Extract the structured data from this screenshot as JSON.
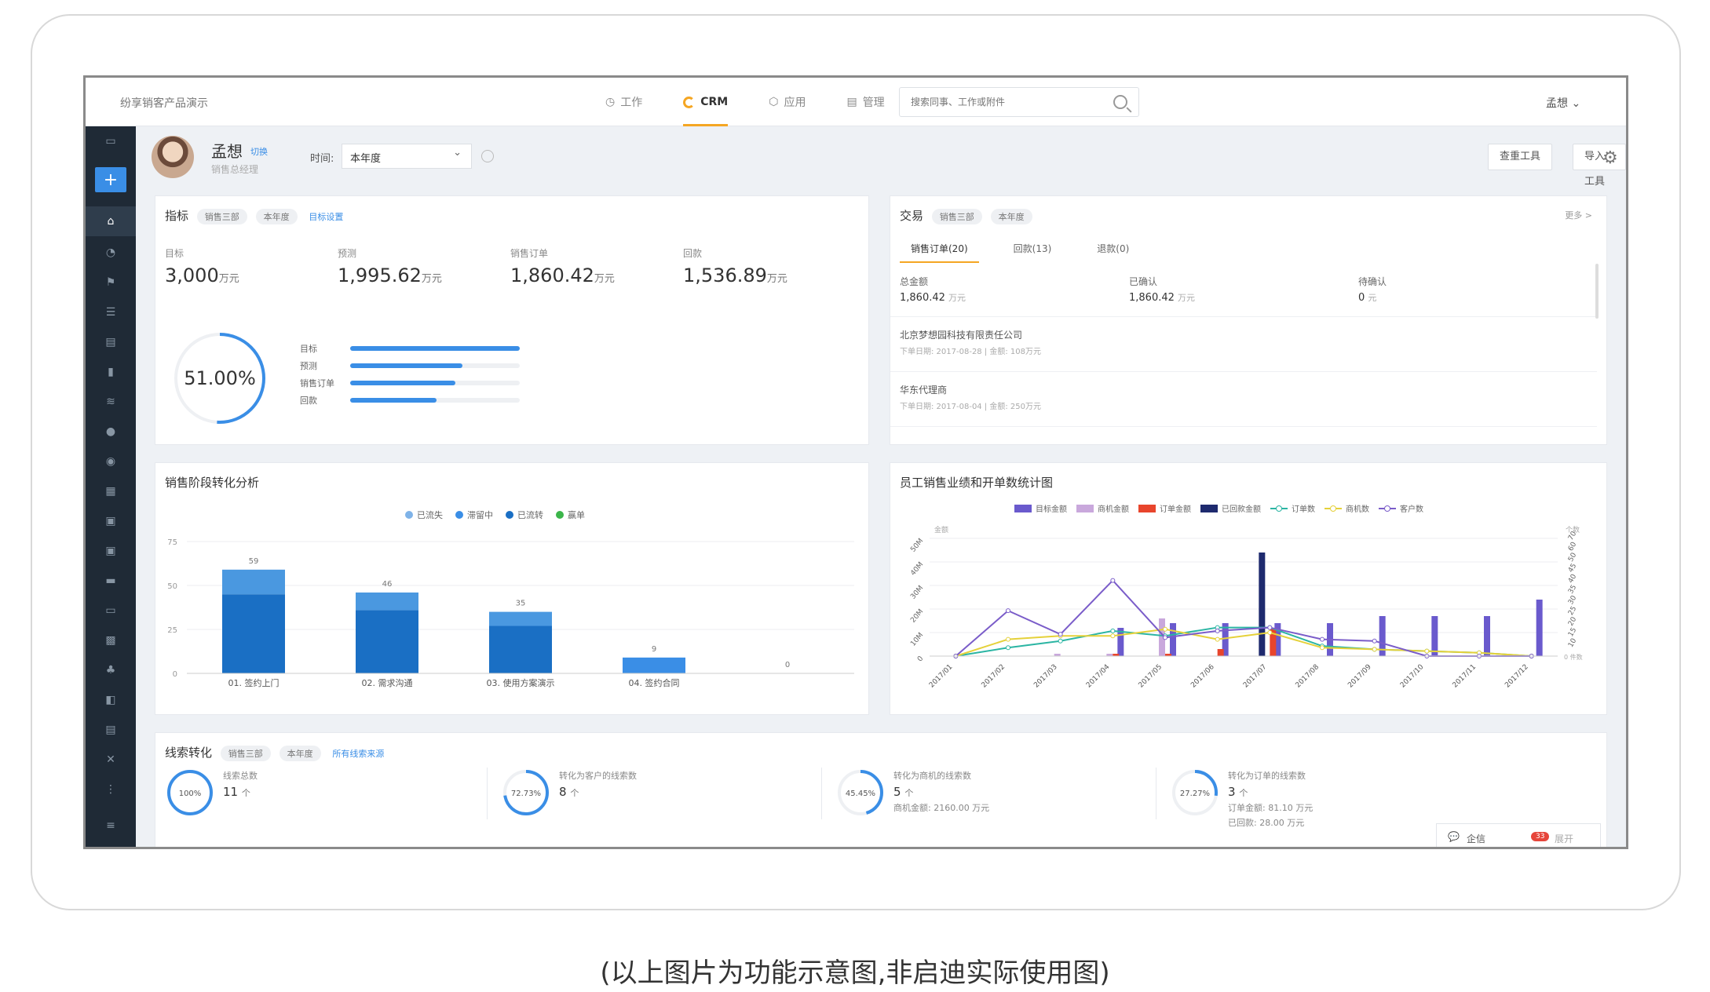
{
  "brand": "纷享销客产品演示",
  "nav": [
    {
      "label": "工作",
      "icon": "clock-icon"
    },
    {
      "label": "CRM",
      "icon": "pie-icon"
    },
    {
      "label": "应用",
      "icon": "cube-icon"
    },
    {
      "label": "管理",
      "icon": "doc-icon"
    }
  ],
  "search_placeholder": "搜索同事、工作或附件",
  "user_menu": "孟想 ⌄",
  "profile": {
    "name": "孟想",
    "switch": "切换",
    "title": "销售总经理"
  },
  "time_label": "时间:",
  "time_value": "本年度",
  "buttons": {
    "query": "查重工具",
    "import": "导入工具"
  },
  "indicators": {
    "title": "指标",
    "tags": [
      "销售三部",
      "本年度"
    ],
    "link": "目标设置",
    "kpis": [
      {
        "label": "目标",
        "value": "3,000",
        "unit": "万元"
      },
      {
        "label": "预测",
        "value": "1,995.62",
        "unit": "万元"
      },
      {
        "label": "销售订单",
        "value": "1,860.42",
        "unit": "万元"
      },
      {
        "label": "回款",
        "value": "1,536.89",
        "unit": "万元"
      }
    ],
    "ring_percent": "51.00%",
    "ring_fraction": 0.51,
    "bars": [
      {
        "label": "目标",
        "fraction": 1.0
      },
      {
        "label": "预测",
        "fraction": 0.66
      },
      {
        "label": "销售订单",
        "fraction": 0.62
      },
      {
        "label": "回款",
        "fraction": 0.51
      }
    ]
  },
  "trade": {
    "title": "交易",
    "tags": [
      "销售三部",
      "本年度"
    ],
    "more": "更多 >",
    "tabs": [
      "销售订单(20)",
      "回款(13)",
      "退款(0)"
    ],
    "summary": [
      {
        "label": "总金额",
        "value": "1,860.42",
        "unit": "万元"
      },
      {
        "label": "已确认",
        "value": "1,860.42",
        "unit": "万元"
      },
      {
        "label": "待确认",
        "value": "0",
        "unit": "元"
      }
    ],
    "orders": [
      {
        "name": "北京梦想园科技有限责任公司",
        "meta": "下单日期: 2017-08-28 | 金额: 108万元"
      },
      {
        "name": "华东代理商",
        "meta": "下单日期: 2017-08-04 | 金额: 250万元"
      }
    ]
  },
  "funnel": {
    "title": "销售阶段转化分析",
    "legend": [
      {
        "name": "已流失",
        "color": "#7fb3e8"
      },
      {
        "name": "滞留中",
        "color": "#3a8ee6"
      },
      {
        "name": "已流转",
        "color": "#1a6fc4"
      },
      {
        "name": "赢单",
        "color": "#3bb54a"
      }
    ]
  },
  "staff": {
    "title": "员工销售业绩和开单数统计图",
    "legend_bars": [
      {
        "name": "目标金额",
        "color": "#6a5acd"
      },
      {
        "name": "商机金额",
        "color": "#c9a8dc"
      },
      {
        "name": "订单金额",
        "color": "#e8452c"
      },
      {
        "name": "已回款金额",
        "color": "#1e2a6e"
      }
    ],
    "legend_lines": [
      {
        "name": "订单数",
        "color": "#2bb5a3"
      },
      {
        "name": "商机数",
        "color": "#e5d13a"
      },
      {
        "name": "客户数",
        "color": "#7a5cc9"
      }
    ],
    "left_axis_title": "金额",
    "right_axis_title": "个数",
    "right_bottom_label": "0 件数"
  },
  "clues": {
    "title": "线索转化",
    "tags": [
      "销售三部",
      "本年度"
    ],
    "link": "所有线索来源",
    "items": [
      {
        "pct": "100%",
        "fraction": 1.0,
        "label": "线索总数",
        "value": "11",
        "unit": "个",
        "subs": []
      },
      {
        "pct": "72.73%",
        "fraction": 0.7273,
        "label": "转化为客户的线索数",
        "value": "8",
        "unit": "个",
        "subs": []
      },
      {
        "pct": "45.45%",
        "fraction": 0.4545,
        "label": "转化为商机的线索数",
        "value": "5",
        "unit": "个",
        "subs": [
          "商机金额: 2160.00 万元"
        ]
      },
      {
        "pct": "27.27%",
        "fraction": 0.2727,
        "label": "转化为订单的线索数",
        "value": "3",
        "unit": "个",
        "subs": [
          "订单金额: 81.10 万元",
          "已回款: 28.00 万元"
        ]
      }
    ]
  },
  "chat": {
    "label": "企信",
    "badge": "33",
    "expand": "展开"
  },
  "caption": "(以上图片为功能示意图,非启迪实际使用图)",
  "chart_data": [
    {
      "type": "bar",
      "title": "销售阶段转化分析",
      "categories": [
        "01. 签约上门",
        "02. 需求沟通",
        "03. 使用方案演示",
        "04. 签约合同"
      ],
      "value_labels": [
        "59",
        "46",
        "35",
        "9",
        "0"
      ],
      "series": [
        {
          "name": "已流失",
          "values": [
            14,
            10,
            8,
            0
          ]
        },
        {
          "name": "滞留中",
          "values": [
            0,
            0,
            0,
            0
          ]
        },
        {
          "name": "已流转",
          "values": [
            45,
            36,
            27,
            9
          ]
        },
        {
          "name": "赢单",
          "values": [
            0,
            0,
            0,
            0
          ]
        }
      ],
      "totals": [
        59,
        46,
        35,
        9,
        0
      ],
      "yticks": [
        0,
        25,
        50,
        75
      ],
      "ylim": [
        0,
        75
      ],
      "grid": true,
      "legend": "top"
    },
    {
      "type": "bar",
      "title": "员工销售业绩和开单数统计图",
      "categories": [
        "2017/01",
        "2017/02",
        "2017/03",
        "2017/04",
        "2017/05",
        "2017/06",
        "2017/07",
        "2017/08",
        "2017/09",
        "2017/10",
        "2017/11",
        "2017/12"
      ],
      "yticks_left": [
        "0",
        "10M",
        "20M",
        "30M",
        "40M",
        "50M"
      ],
      "yticks_right": [
        "10",
        "15",
        "20",
        "25",
        "30",
        "35",
        "40",
        "45",
        "50",
        "60",
        "70"
      ],
      "ylim_left": [
        0,
        50
      ],
      "ylim_right": [
        0,
        70
      ],
      "series": [
        {
          "name": "目标金额",
          "kind": "bar",
          "values": [
            0,
            0,
            0,
            12,
            14,
            14,
            14,
            14,
            17,
            17,
            17,
            24
          ]
        },
        {
          "name": "商机金额",
          "kind": "bar",
          "values": [
            0,
            0,
            1,
            1,
            16,
            0,
            0,
            0,
            0,
            0,
            0,
            0
          ]
        },
        {
          "name": "订单金额",
          "kind": "bar",
          "values": [
            0,
            0,
            0,
            1,
            1,
            3,
            12,
            0,
            0,
            0,
            0,
            0
          ]
        },
        {
          "name": "已回款金额",
          "kind": "bar",
          "values": [
            0,
            0,
            0,
            0,
            0,
            0,
            44,
            0,
            0,
            0,
            0,
            0
          ]
        },
        {
          "name": "订单数",
          "kind": "line",
          "values": [
            0,
            5,
            9,
            15,
            12,
            17,
            17,
            6,
            4,
            3,
            2,
            0
          ]
        },
        {
          "name": "商机数",
          "kind": "line",
          "values": [
            0,
            10,
            12,
            12,
            16,
            10,
            14,
            5,
            4,
            3,
            2,
            0
          ]
        },
        {
          "name": "客户数",
          "kind": "line",
          "values": [
            0,
            27,
            13,
            45,
            11,
            15,
            17,
            10,
            9,
            0,
            0,
            0
          ]
        }
      ],
      "grid": true,
      "legend": "top"
    }
  ]
}
